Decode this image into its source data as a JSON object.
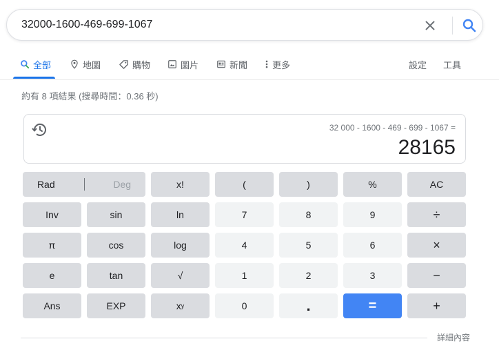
{
  "search": {
    "query": "32000-1600-469-699-1067"
  },
  "tabs": [
    {
      "label": "全部",
      "icon": "search-icon",
      "active": true
    },
    {
      "label": "地圖",
      "icon": "map-pin-icon"
    },
    {
      "label": "購物",
      "icon": "tag-icon"
    },
    {
      "label": "圖片",
      "icon": "image-icon"
    },
    {
      "label": "新聞",
      "icon": "news-icon"
    },
    {
      "label": "更多",
      "icon": "more-vert-icon"
    }
  ],
  "tools": {
    "settings": "設定",
    "tools": "工具"
  },
  "stats": "約有 8 項結果 (搜尋時間：0.36 秒)",
  "calculator": {
    "expression": "32 000 - 1600 - 469 - 699 - 1067 =",
    "result": "28165",
    "keys": {
      "rad": "Rad",
      "deg": "Deg",
      "fact": "x!",
      "lparen": "(",
      "rparen": ")",
      "percent": "%",
      "ac": "AC",
      "inv": "Inv",
      "sin": "sin",
      "ln": "ln",
      "n7": "7",
      "n8": "8",
      "n9": "9",
      "div": "÷",
      "pi": "π",
      "cos": "cos",
      "log": "log",
      "n4": "4",
      "n5": "5",
      "n6": "6",
      "mul": "×",
      "e": "e",
      "tan": "tan",
      "sqrt": "√",
      "n1": "1",
      "n2": "2",
      "n3": "3",
      "sub": "−",
      "ans": "Ans",
      "exp": "EXP",
      "pow_base": "x",
      "pow_exp": "y",
      "n0": "0",
      "dot": ".",
      "eq": "=",
      "add": "+"
    }
  },
  "more_info": "詳細內容",
  "colors": {
    "accent": "#1a73e8",
    "equals": "#4285f4",
    "fn_key": "#dadce0",
    "num_key": "#f1f3f4"
  }
}
